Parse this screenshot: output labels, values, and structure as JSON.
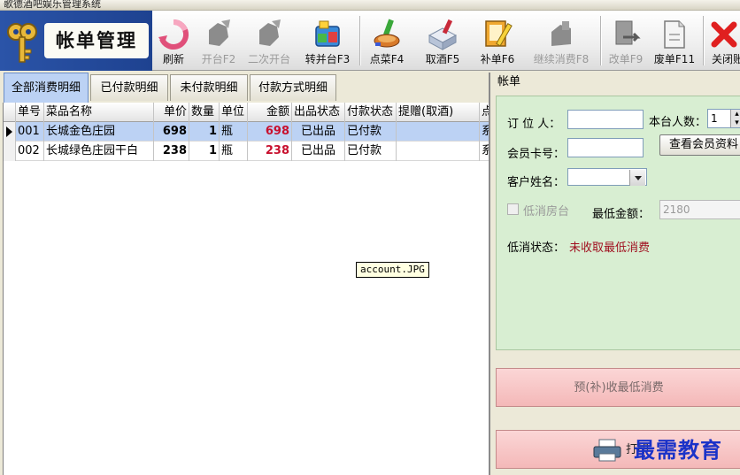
{
  "window": {
    "title": "歌德酒吧娱乐管理系统"
  },
  "logo": {
    "text": "帐单管理"
  },
  "toolbar": {
    "buttons": [
      {
        "label": "刷新",
        "icon": "refresh-icon",
        "enabled": true
      },
      {
        "label": "开台F2",
        "icon": "open-table-icon",
        "enabled": false
      },
      {
        "label": "二次开台",
        "icon": "reopen-table-icon",
        "enabled": false
      },
      {
        "label": "转并台F3",
        "icon": "transfer-table-icon",
        "enabled": true
      },
      {
        "label": "点菜F4",
        "icon": "order-icon",
        "enabled": true
      },
      {
        "label": "取酒F5",
        "icon": "take-wine-icon",
        "enabled": true
      },
      {
        "label": "补单F6",
        "icon": "supplement-order-icon",
        "enabled": true
      },
      {
        "label": "继续消费F8",
        "icon": "continue-consume-icon",
        "enabled": false
      },
      {
        "label": "改单F9",
        "icon": "edit-order-icon",
        "enabled": false
      },
      {
        "label": "废单F11",
        "icon": "void-order-icon",
        "enabled": true
      },
      {
        "label": "关闭账",
        "icon": "close-icon",
        "enabled": true
      }
    ]
  },
  "tabs": [
    {
      "label": "全部消费明细",
      "active": true
    },
    {
      "label": "已付款明细",
      "active": false
    },
    {
      "label": "未付款明细",
      "active": false
    },
    {
      "label": "付款方式明细",
      "active": false
    }
  ],
  "table": {
    "columns": [
      "单号",
      "菜品名称",
      "单价",
      "数量",
      "单位",
      "金额",
      "出品状态",
      "付款状态",
      "提赠(取酒)",
      "点"
    ],
    "rows": [
      {
        "id": "001",
        "name": "长城金色庄园",
        "price": "698",
        "qty": "1",
        "unit": "瓶",
        "amount": "698",
        "serve_status": "已出品",
        "pay_status": "已付款",
        "gift": "",
        "extra": "系"
      },
      {
        "id": "002",
        "name": "长城绿色庄园干白",
        "price": "238",
        "qty": "1",
        "unit": "瓶",
        "amount": "238",
        "serve_status": "已出品",
        "pay_status": "已付款",
        "gift": "",
        "extra": "系"
      }
    ]
  },
  "tooltip": {
    "text": "account.JPG"
  },
  "bill": {
    "title": "帐单",
    "booker_label": "订 位 人：",
    "booker_value": "",
    "people_label": "本台人数：",
    "people_value": "1",
    "member_card_label": "会员卡号：",
    "member_card_value": "",
    "view_member_button": "查看会员资料",
    "customer_name_label": "客户姓名：",
    "customer_name_value": "",
    "min_room_label": "低消房台",
    "min_amount_label": "最低金额：",
    "min_amount_value": "2180",
    "min_status_label": "低消状态：",
    "min_status_value": "未收取最低消费",
    "prepay_button": "预(补)收最低消费",
    "print_button": "打印"
  },
  "watermark": "最需教育",
  "colors": {
    "accent": "#bcd2f4",
    "amount": "#c8102e",
    "status": "#a01020",
    "panel": "#d8eed2"
  }
}
